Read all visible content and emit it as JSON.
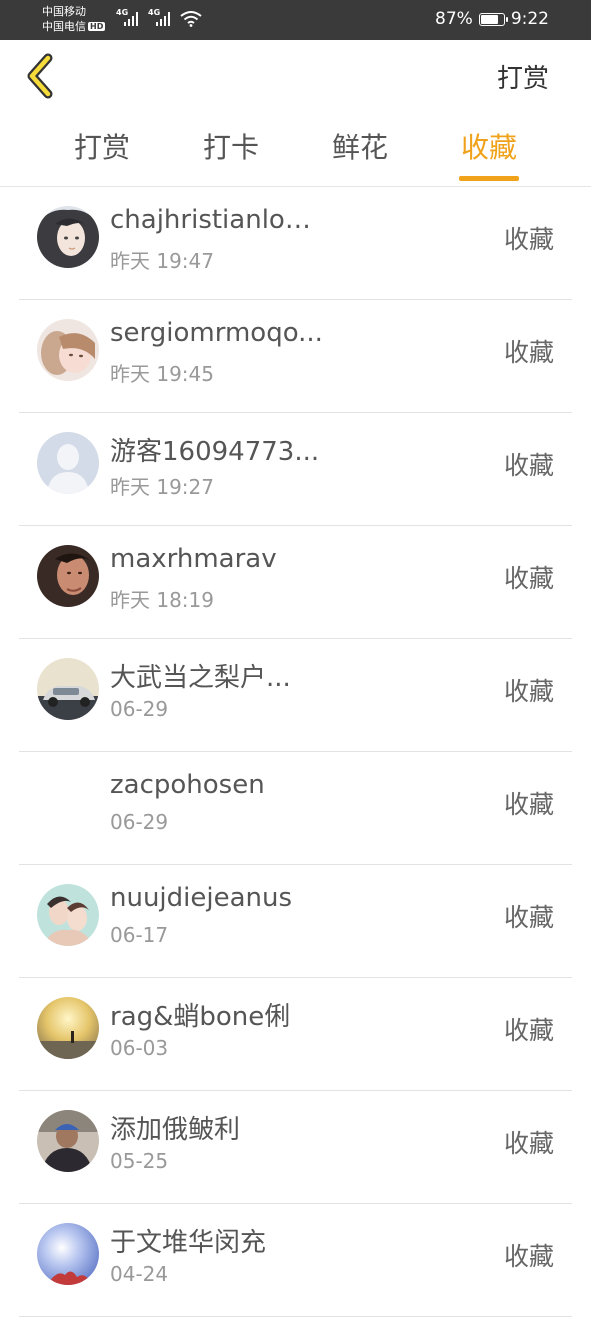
{
  "status_bar": {
    "carrier1": "中国移动",
    "carrier2": "中国电信",
    "hd": "HD",
    "network": "4G",
    "battery_percent": "87%",
    "battery_level": 0.87,
    "time": "9:22"
  },
  "header": {
    "back_icon": "chevron-left-icon",
    "title": "打赏"
  },
  "tabs": [
    {
      "label": "打赏",
      "active": false
    },
    {
      "label": "打卡",
      "active": false
    },
    {
      "label": "鲜花",
      "active": false
    },
    {
      "label": "收藏",
      "active": true
    }
  ],
  "colors": {
    "accent": "#f0a21b",
    "status_bar": "#3a3a3a",
    "text": "#555555",
    "subtext": "#999999"
  },
  "list": {
    "items": [
      {
        "name": "chajhristianlou...",
        "time": "昨天 19:47",
        "action": "收藏",
        "avatar": "illustrated-girl-avatar"
      },
      {
        "name": "sergiomrmoqo...",
        "time": "昨天 19:45",
        "action": "收藏",
        "avatar": "photo-avatar"
      },
      {
        "name": "游客16094773...",
        "time": "昨天 19:27",
        "action": "收藏",
        "avatar": "default-person-avatar"
      },
      {
        "name": "maxrhmarav",
        "time": "昨天 18:19",
        "action": "收藏",
        "avatar": "man-photo-avatar"
      },
      {
        "name": "大武当之梨户...",
        "time": "06-29",
        "action": "收藏",
        "avatar": "car-photo-avatar"
      },
      {
        "name": "zacpohosen",
        "time": "06-29",
        "action": "收藏",
        "avatar": ""
      },
      {
        "name": "nuujdiejeanus",
        "time": "06-17",
        "action": "收藏",
        "avatar": "couple-illustration-avatar"
      },
      {
        "name": "rag&蛸bone俐",
        "time": "06-03",
        "action": "收藏",
        "avatar": "sunset-photo-avatar"
      },
      {
        "name": "添加俄鲏利",
        "time": "05-25",
        "action": "收藏",
        "avatar": "person-photo-avatar"
      },
      {
        "name": "于文堆华闵充",
        "time": "04-24",
        "action": "收藏",
        "avatar": "sky-photo-avatar"
      }
    ]
  }
}
